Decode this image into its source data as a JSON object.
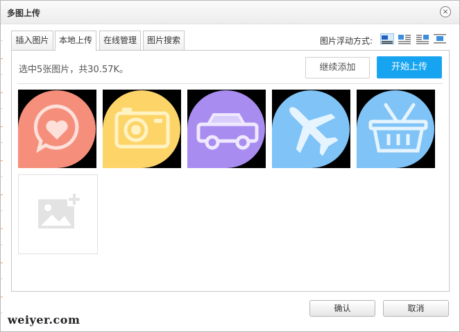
{
  "dialog": {
    "title": "多图上传",
    "close_symbol": "×"
  },
  "tabs": [
    {
      "label": "插入图片",
      "active": false
    },
    {
      "label": "本地上传",
      "active": true
    },
    {
      "label": "在线管理",
      "active": false
    },
    {
      "label": "图片搜索",
      "active": false
    }
  ],
  "float_mode": {
    "label": "图片浮动方式:",
    "options": [
      "none-icon",
      "left-icon",
      "center-icon",
      "right-icon"
    ],
    "selected": "none-icon"
  },
  "upload": {
    "status": "选中5张图片，共30.57K。",
    "continue_label": "继续添加",
    "start_label": "开始上传"
  },
  "thumbnails": [
    {
      "icon": "heart-chat-icon",
      "color": "#f58f7c"
    },
    {
      "icon": "camera-icon",
      "color": "#fdd468"
    },
    {
      "icon": "car-icon",
      "color": "#a98cf0"
    },
    {
      "icon": "airplane-icon",
      "color": "#7fc3f7"
    },
    {
      "icon": "basket-icon",
      "color": "#7fc3f7"
    }
  ],
  "footer": {
    "confirm_label": "确认",
    "cancel_label": "取消"
  },
  "watermark": "weiyer.com",
  "colors": {
    "primary_button": "#16a4f1"
  }
}
